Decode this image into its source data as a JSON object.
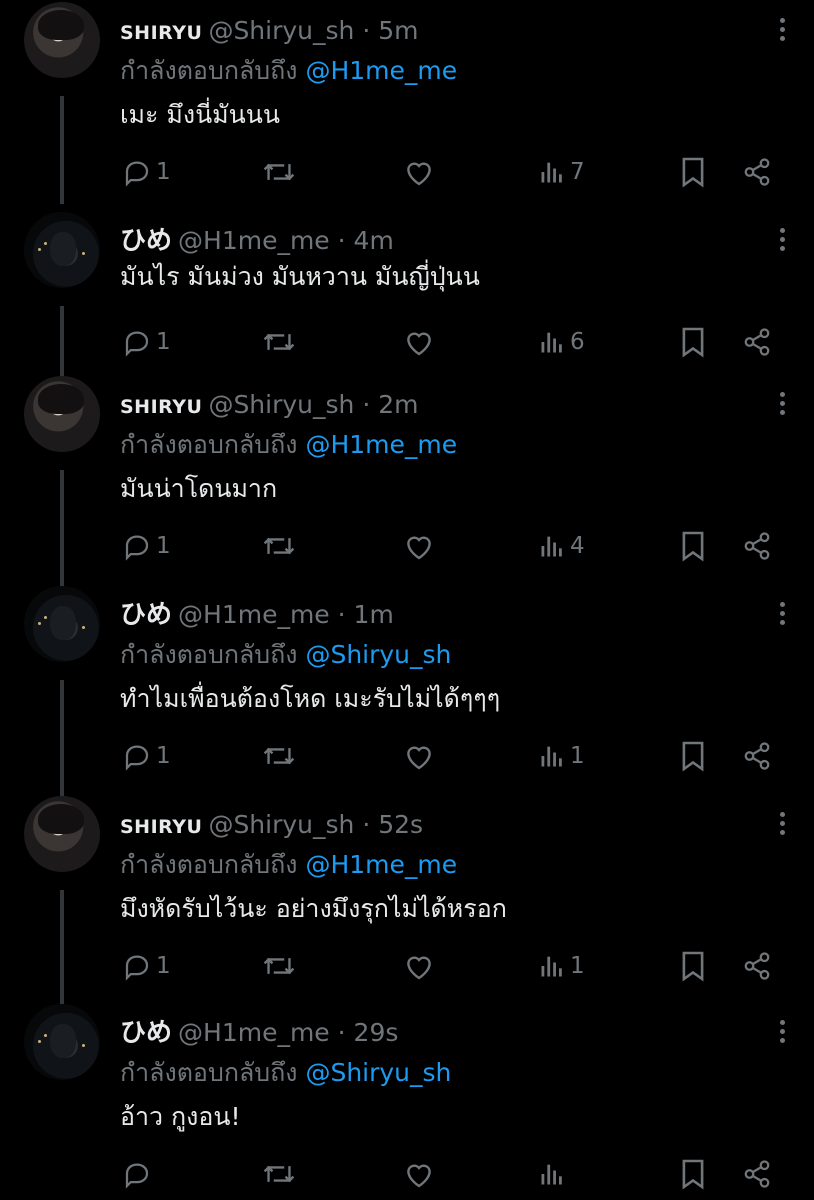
{
  "tweets": [
    {
      "name": "SHIRYU",
      "handle": "@Shiryu_sh",
      "time": "5m",
      "reply_prefix": "กำลังตอบกลับถึง",
      "reply_mention": "@H1me_me",
      "text": "เมะ มึงนี่มันนน",
      "replies": "1",
      "retweets": "",
      "likes": "",
      "views": "7"
    },
    {
      "name": "ひめ",
      "handle": "@H1me_me",
      "time": "4m",
      "reply_prefix": "",
      "reply_mention": "",
      "text": "มันไร มันม่วง มันหวาน มันญี่ปุ่นน",
      "replies": "1",
      "retweets": "",
      "likes": "",
      "views": "6"
    },
    {
      "name": "SHIRYU",
      "handle": "@Shiryu_sh",
      "time": "2m",
      "reply_prefix": "กำลังตอบกลับถึง",
      "reply_mention": "@H1me_me",
      "text": "มันน่าโดนมาก",
      "replies": "1",
      "retweets": "",
      "likes": "",
      "views": "4"
    },
    {
      "name": "ひめ",
      "handle": "@H1me_me",
      "time": "1m",
      "reply_prefix": "กำลังตอบกลับถึง",
      "reply_mention": "@Shiryu_sh",
      "text": "ทำไมเพื่อนต้องโหด เมะรับไม่ได้ๆๆๆ",
      "replies": "1",
      "retweets": "",
      "likes": "",
      "views": "1"
    },
    {
      "name": "SHIRYU",
      "handle": "@Shiryu_sh",
      "time": "52s",
      "reply_prefix": "กำลังตอบกลับถึง",
      "reply_mention": "@H1me_me",
      "text": "มึงหัดรับไว้นะ อย่างมึงรุกไม่ได้หรอก",
      "replies": "1",
      "retweets": "",
      "likes": "",
      "views": "1"
    },
    {
      "name": "ひめ",
      "handle": "@H1me_me",
      "time": "29s",
      "reply_prefix": "กำลังตอบกลับถึง",
      "reply_mention": "@Shiryu_sh",
      "text": "อ้าว กูงอน!",
      "replies": "",
      "retweets": "",
      "likes": "",
      "views": ""
    }
  ],
  "icons": {
    "reply": "reply-icon",
    "retweet": "retweet-icon",
    "like": "heart-icon",
    "views": "views-icon",
    "bookmark": "bookmark-icon",
    "share": "share-icon",
    "more": "more-icon"
  },
  "colors": {
    "background": "#000000",
    "text": "#e7e9ea",
    "muted": "#71767b",
    "mention": "#1d9bf0",
    "thread_line": "#333639"
  }
}
